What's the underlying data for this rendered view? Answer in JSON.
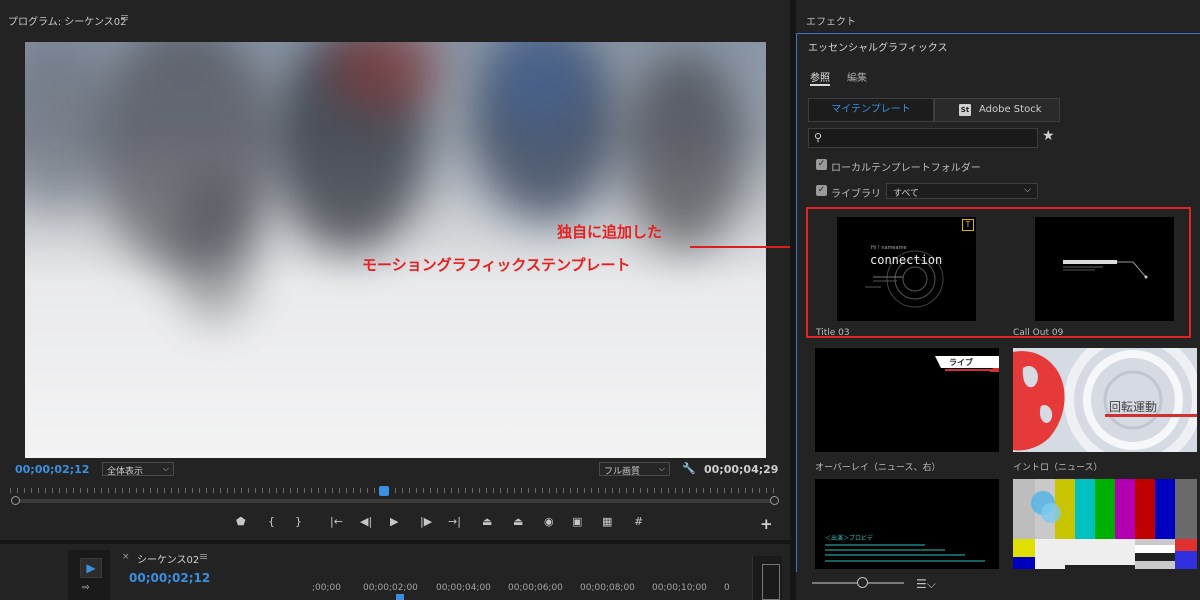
{
  "program": {
    "title": "プログラム: シーケンス02",
    "menu_icon": "≡",
    "timecode_current": "00;00;02;12",
    "timecode_duration": "00;00;04;29",
    "fit_dropdown": "全体表示",
    "quality_dropdown": "フル画質",
    "dropdown_arrow": "⌵",
    "wrench_icon": "🔧",
    "add_icon": "+",
    "playhead_fraction": 0.485
  },
  "annotation": {
    "line1": "独自に追加した",
    "line2": "モーショングラフィックステンプレート",
    "color": "#e81f1f"
  },
  "transport": {
    "marker": "⬟",
    "in": "{",
    "out": "}",
    "go_in": "|←",
    "step_back": "◀|",
    "play": "▶",
    "step_fwd": "|▶",
    "go_out": "→|",
    "lift": "⏏",
    "extract": "⏏",
    "export_frame": "◉",
    "compare": "▣",
    "safe_margins": "▦",
    "grid": "#"
  },
  "timeline": {
    "close_icon": "×",
    "title": "シーケンス02",
    "menu_icon": "≡",
    "timecode": "00;00;02;12",
    "ticks": [
      ";00;00",
      "00;00;02;00",
      "00;00;04;00",
      "00;00;06;00",
      "00;00;08;00",
      "00;00;10;00",
      "0"
    ],
    "selection_tool_icon": "▶",
    "track_tool_icon": "⇨"
  },
  "effects": {
    "title": "エフェクト"
  },
  "essential_graphics": {
    "title": "エッセンシャルグラフィックス",
    "tab_browse": "参照",
    "tab_edit": "編集",
    "seg_my_templates": "マイテンプレート",
    "seg_adobe_stock": "Adobe Stock",
    "stock_icon": "St",
    "search_placeholder": "",
    "star_icon": "★",
    "search_icon": "⚲",
    "check_mark": "✓",
    "local_folder_label": "ローカルテンプレートフォルダー",
    "library_label": "ライブラリ",
    "library_value": "すべて",
    "list_icon": "☰⌵",
    "templates": [
      {
        "caption": "Title 03",
        "thumb_text": "connection",
        "thumb_small": "Hi ! nameame",
        "badge": "T"
      },
      {
        "caption": "Call Out 09"
      },
      {
        "caption": "オーバーレイ（ニュース、右）",
        "thumb_text": "ライブ"
      },
      {
        "caption": "イントロ（ニュース）",
        "thumb_text": "回転運動"
      },
      {
        "caption": "",
        "thumb_text": "＜出演＞プロビデ"
      },
      {
        "caption": ""
      }
    ]
  },
  "colors": {
    "accent_blue": "#3a8fe0",
    "highlight_red": "#e02424",
    "panel_bg": "#232323"
  }
}
